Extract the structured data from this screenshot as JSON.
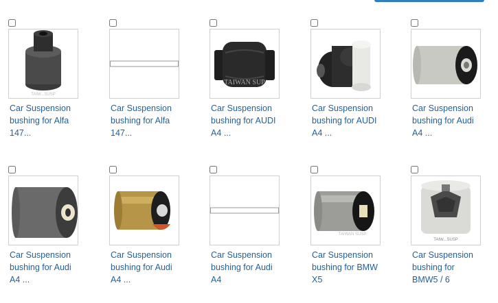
{
  "header": {
    "action_button": ""
  },
  "products": [
    {
      "line1": "Car Suspension",
      "line2": "bushing for Alfa",
      "line3": "147...",
      "icon": "black-cylinder-bushing",
      "watermark": "TAIW...SUSP"
    },
    {
      "line1": "Car Suspension",
      "line2": "bushing for Alfa",
      "line3": "147...",
      "icon": "image-placeholder"
    },
    {
      "line1": "Car Suspension",
      "line2": "bushing for AUDI",
      "line3": "A4 ...",
      "icon": "black-rubber-bushing",
      "watermark": "TAIWAN SUP"
    },
    {
      "line1": "Car Suspension",
      "line2": "bushing for AUDI",
      "line3": "A4 ...",
      "icon": "two-tone-bushing"
    },
    {
      "line1": "Car Suspension",
      "line2": "bushing for Audi",
      "line3": "A4 ...",
      "icon": "silver-bushing"
    },
    {
      "line1": "Car Suspension",
      "line2": "bushing for Audi",
      "line3": "A4 ...",
      "icon": "gray-bushing"
    },
    {
      "line1": "Car Suspension",
      "line2": "bushing for Audi",
      "line3": "A4 ...",
      "icon": "brass-bushing"
    },
    {
      "line1": "Car Suspension",
      "line2": "bushing for Audi",
      "line3": "A4",
      "icon": "image-placeholder"
    },
    {
      "line1": "Car Suspension",
      "line2": "bushing for BMW",
      "line3": "X5",
      "icon": "steel-bushing",
      "watermark": "TAIWAN SUSP"
    },
    {
      "line1": "Car Suspension",
      "line2": "bushing for",
      "line3": "BMW5 / 6",
      "icon": "mount-bushing",
      "watermark": "TAIW...SUSP"
    }
  ]
}
